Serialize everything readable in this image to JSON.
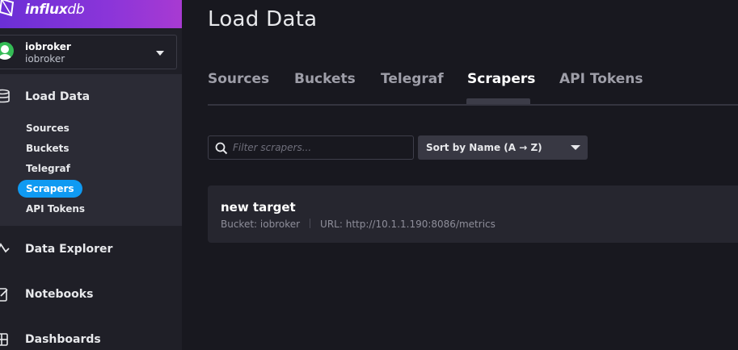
{
  "brand": {
    "name_bold": "influx",
    "name_thin": "db"
  },
  "org": {
    "name": "iobroker",
    "sub": "iobroker"
  },
  "sidebar": {
    "items": [
      {
        "label": "Load Data"
      },
      {
        "label": "Data Explorer"
      },
      {
        "label": "Notebooks"
      },
      {
        "label": "Dashboards"
      }
    ],
    "sub_items": [
      {
        "label": "Sources"
      },
      {
        "label": "Buckets"
      },
      {
        "label": "Telegraf"
      },
      {
        "label": "Scrapers",
        "active": true
      },
      {
        "label": "API Tokens"
      }
    ]
  },
  "page": {
    "title": "Load Data"
  },
  "tabs": [
    {
      "label": "Sources"
    },
    {
      "label": "Buckets"
    },
    {
      "label": "Telegraf"
    },
    {
      "label": "Scrapers",
      "active": true
    },
    {
      "label": "API Tokens"
    }
  ],
  "filter": {
    "placeholder": "Filter scrapers..."
  },
  "sort": {
    "label": "Sort by Name (A → Z)"
  },
  "scrapers": [
    {
      "name": "new target",
      "bucket": "Bucket: iobroker",
      "url": "URL: http://10.1.1.190:8086/metrics"
    }
  ],
  "colors": {
    "accent": "#0f9af2",
    "brand_start": "#6b2fd6",
    "brand_end": "#a83ad2",
    "avatar": "#34bb55"
  }
}
